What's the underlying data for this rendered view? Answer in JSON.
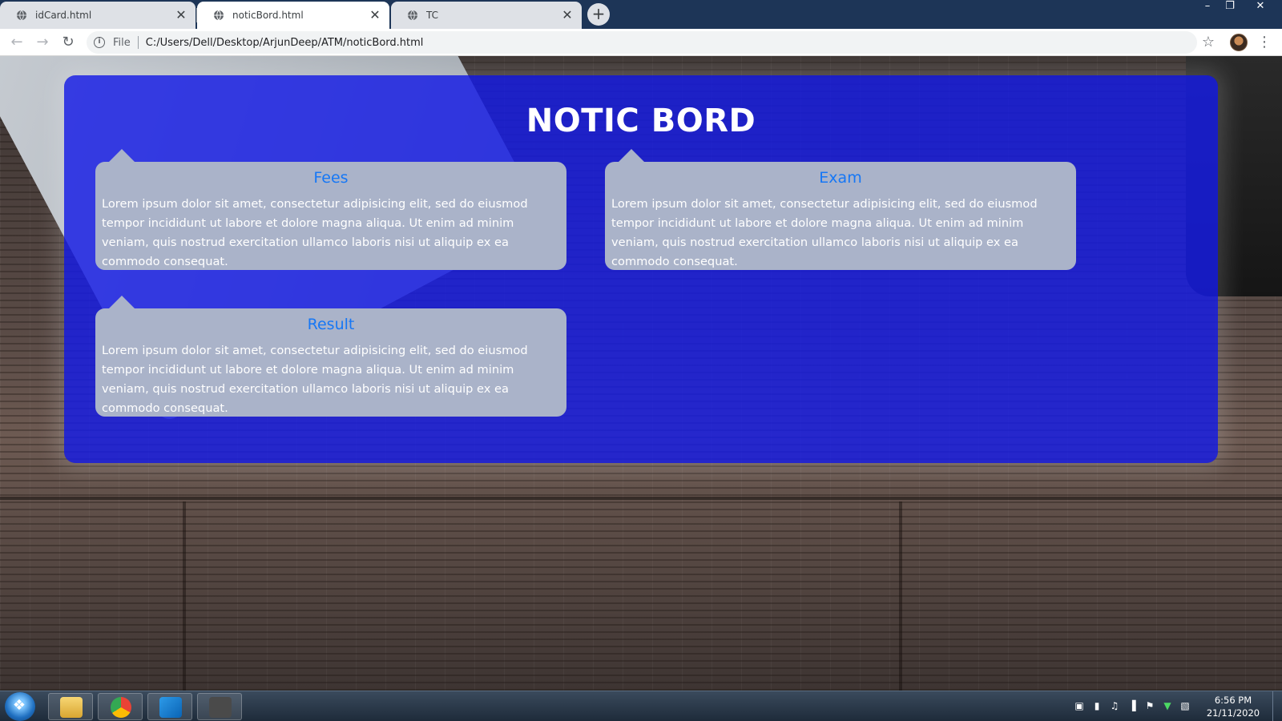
{
  "browser": {
    "tabs": [
      {
        "title": "idCard.html",
        "active": false
      },
      {
        "title": "noticBord.html",
        "active": true
      },
      {
        "title": "TC",
        "active": false
      }
    ],
    "new_tab_symbol": "+",
    "close_symbol": "✕",
    "omnibox": {
      "scheme_label": "File",
      "url": "C:/Users/Dell/Desktop/ArjunDeep/ATM/noticBord.html"
    }
  },
  "page": {
    "title": "NOTIC BORD",
    "notices": [
      {
        "title": "Fees",
        "body": "Lorem ipsum dolor sit amet, consectetur adipisicing elit, sed do eiusmod tempor incididunt ut labore et dolore magna aliqua. Ut enim ad minim veniam, quis nostrud exercitation ullamco laboris nisi ut aliquip ex ea commodo consequat."
      },
      {
        "title": "Exam",
        "body": "Lorem ipsum dolor sit amet, consectetur adipisicing elit, sed do eiusmod tempor incididunt ut labore et dolore magna aliqua. Ut enim ad minim veniam, quis nostrud exercitation ullamco laboris nisi ut aliquip ex ea commodo consequat."
      },
      {
        "title": "Result",
        "body": "Lorem ipsum dolor sit amet, consectetur adipisicing elit, sed do eiusmod tempor incididunt ut labore et dolore magna aliqua. Ut enim ad minim veniam, quis nostrud exercitation ullamco laboris nisi ut aliquip ex ea commodo consequat."
      }
    ]
  },
  "taskbar": {
    "apps": [
      "file-explorer-icon",
      "chrome-icon",
      "vscode-icon",
      "sublime-text-icon"
    ],
    "time": "6:56 PM",
    "date": "21/11/2020"
  },
  "colors": {
    "panel": "#161ce6",
    "card": "#aab3c9",
    "card_title": "#1677f5"
  }
}
